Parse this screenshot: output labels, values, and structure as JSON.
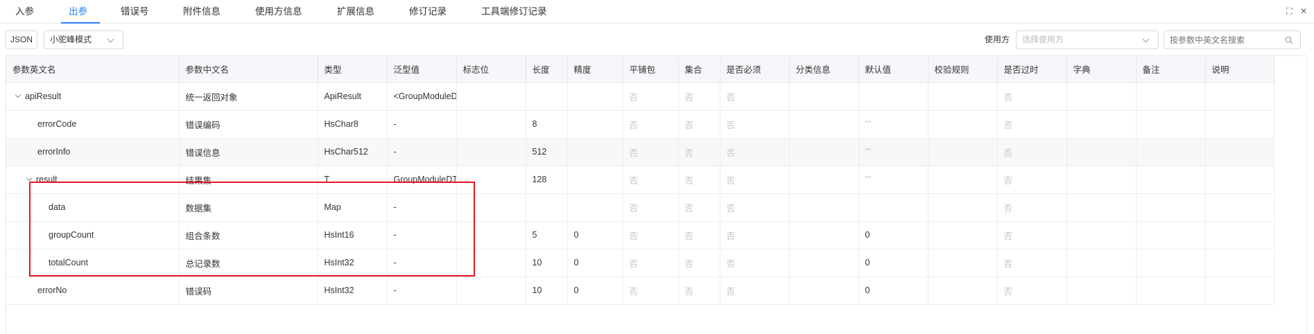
{
  "tabs": [
    "入参",
    "出参",
    "错误号",
    "附件信息",
    "使用方信息",
    "扩展信息",
    "修订记录",
    "工具端修订记录"
  ],
  "window_icons": [
    "⛶",
    "✕"
  ],
  "toolbar": {
    "json_label": "JSON",
    "mode_value": "小驼峰模式",
    "user_label": "使用方",
    "user_placeholder": "选择使用方",
    "search_placeholder": "按参数中英文名搜索"
  },
  "table": {
    "columns": [
      "参数英文名",
      "参数中文名",
      "类型",
      "泛型值",
      "标志位",
      "长度",
      "精度",
      "平铺包",
      "集合",
      "是否必须",
      "分类信息",
      "默认值",
      "校验规则",
      "是否过时",
      "字典",
      "备注",
      "说明"
    ],
    "rows": [
      {
        "en": "apiResult",
        "cn": "统一返回对象",
        "type": "ApiResult",
        "generic": "<GroupModuleD",
        "flag": "",
        "length": "",
        "precision": "",
        "flat": "否",
        "collection": "否",
        "required": "否",
        "category": "",
        "default": "",
        "check": "",
        "deprecated": "否",
        "dict": "",
        "remark": "",
        "desc": ""
      },
      {
        "en": "errorCode",
        "cn": "错误编码",
        "type": "HsChar8",
        "generic": "-",
        "flag": "",
        "length": "8",
        "precision": "",
        "flat": "否",
        "collection": "否",
        "required": "否",
        "category": "",
        "default": "\"\"",
        "check": "",
        "deprecated": "否",
        "dict": "",
        "remark": "",
        "desc": ""
      },
      {
        "en": "errorInfo",
        "cn": "错误信息",
        "type": "HsChar512",
        "generic": "-",
        "flag": "",
        "length": "512",
        "precision": "",
        "flat": "否",
        "collection": "否",
        "required": "否",
        "category": "",
        "default": "\"\"",
        "check": "",
        "deprecated": "否",
        "dict": "",
        "remark": "",
        "desc": ""
      },
      {
        "en": "result",
        "cn": "结果集",
        "type": "T",
        "generic": "GroupModuleDT",
        "flag": "",
        "length": "128",
        "precision": "",
        "flat": "否",
        "collection": "否",
        "required": "否",
        "category": "",
        "default": "\"\"",
        "check": "",
        "deprecated": "否",
        "dict": "",
        "remark": "",
        "desc": ""
      },
      {
        "en": "data",
        "cn": "数据集",
        "type": "Map",
        "generic": "-",
        "flag": "",
        "length": "",
        "precision": "",
        "flat": "否",
        "collection": "否",
        "required": "否",
        "category": "",
        "default": "",
        "check": "",
        "deprecated": "否",
        "dict": "",
        "remark": "",
        "desc": ""
      },
      {
        "en": "groupCount",
        "cn": "组合条数",
        "type": "HsInt16",
        "generic": "-",
        "flag": "",
        "length": "5",
        "precision": "0",
        "flat": "否",
        "collection": "否",
        "required": "否",
        "category": "",
        "default": "0",
        "check": "",
        "deprecated": "否",
        "dict": "",
        "remark": "",
        "desc": ""
      },
      {
        "en": "totalCount",
        "cn": "总记录数",
        "type": "HsInt32",
        "generic": "-",
        "flag": "",
        "length": "10",
        "precision": "0",
        "flat": "否",
        "collection": "否",
        "required": "否",
        "category": "",
        "default": "0",
        "check": "",
        "deprecated": "否",
        "dict": "",
        "remark": "",
        "desc": ""
      },
      {
        "en": "errorNo",
        "cn": "错误码",
        "type": "HsInt32",
        "generic": "-",
        "flag": "",
        "length": "10",
        "precision": "0",
        "flat": "否",
        "collection": "否",
        "required": "否",
        "category": "",
        "default": "0",
        "check": "",
        "deprecated": "否",
        "dict": "",
        "remark": "",
        "desc": ""
      }
    ]
  },
  "colors": {
    "accent": "#2a7ff2",
    "highlight_border": "#e6161b"
  }
}
